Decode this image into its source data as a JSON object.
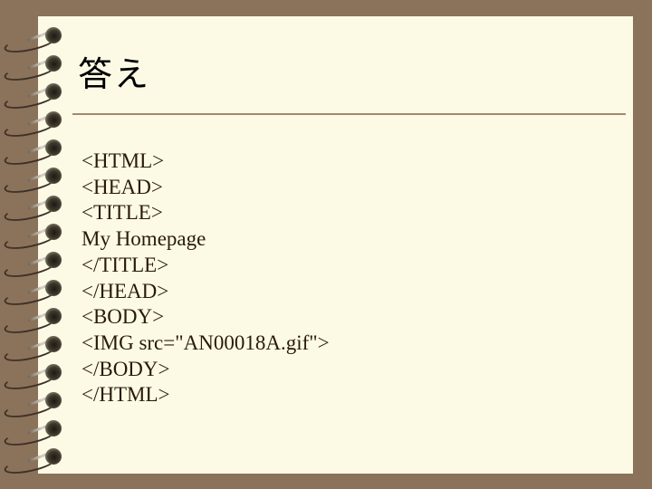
{
  "slide": {
    "title": "答え",
    "code_lines": [
      "<HTML>",
      "<HEAD>",
      "<TITLE>",
      "My Homepage",
      "</TITLE>",
      "</HEAD>",
      "<BODY>",
      "<IMG src=\"AN00018A.gif\">",
      "</BODY>",
      "</HTML>"
    ]
  },
  "decoration": {
    "binding": "spiral-binding-icon",
    "ring_count": 16
  }
}
